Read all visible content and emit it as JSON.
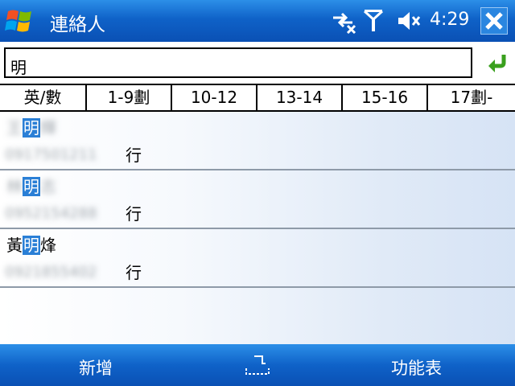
{
  "titlebar": {
    "title": "連絡人",
    "time": "4:29",
    "icons": [
      "windows-start-icon",
      "connectivity-icon",
      "signal-icon",
      "volume-muted-icon",
      "close-icon"
    ]
  },
  "search": {
    "value": "明"
  },
  "tabs": [
    "英/數",
    "1-9劃",
    "10-12",
    "13-14",
    "15-16",
    "17劃-"
  ],
  "contacts": [
    {
      "name_before": "王",
      "name_match": "明",
      "name_after": "輝",
      "name_blurred": true,
      "phone": "0917501211",
      "phone_type": "行"
    },
    {
      "name_before": "林",
      "name_match": "明",
      "name_after": "志",
      "name_blurred": true,
      "phone": "0952154288",
      "phone_type": "行"
    },
    {
      "name_before": "黃",
      "name_match": "明",
      "name_after": "烽",
      "name_blurred": false,
      "phone": "0921855402",
      "phone_type": "行"
    }
  ],
  "softkeys": {
    "left": "新增",
    "right": "功能表"
  },
  "colors": {
    "bar_top": "#2c8fe8",
    "bar_bottom": "#0a50b4",
    "highlight": "#2a7fd6",
    "go_arrow": "#3aa01e"
  }
}
